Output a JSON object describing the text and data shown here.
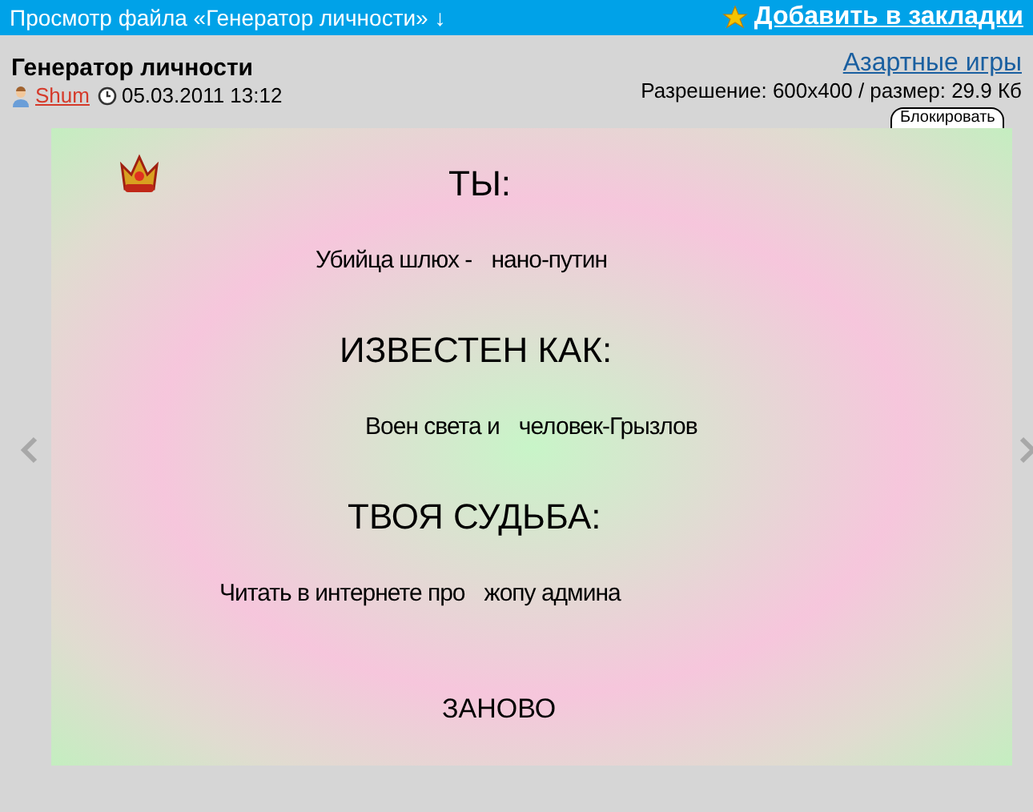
{
  "top_bar": {
    "title": "Просмотр файла «Генератор личности» ↓",
    "bookmark_link": "Добавить в закладки"
  },
  "file": {
    "title": "Генератор личности",
    "author": "Shum",
    "date": "05.03.2011 13:12",
    "category_link": "Азартные игры",
    "info": "Разрешение: 600x400 / размер: 29.9 Кб",
    "block_button": "Блокировать"
  },
  "game": {
    "lines": [
      {
        "kind": "heading",
        "parts": [
          "ТЫ:"
        ]
      },
      {
        "kind": "result",
        "parts": [
          "Убийца шлюх -",
          "нано-путин"
        ]
      },
      {
        "kind": "heading",
        "parts": [
          "ИЗВЕСТЕН КАК:"
        ]
      },
      {
        "kind": "result",
        "parts": [
          "Воен света и",
          "человек-Грызлов"
        ]
      },
      {
        "kind": "heading",
        "parts": [
          "ТВОЯ СУДЬБА:"
        ]
      },
      {
        "kind": "result",
        "parts": [
          "Читать в интернете про",
          "жопу админа"
        ]
      }
    ],
    "again_button": "ЗАНОВО"
  }
}
